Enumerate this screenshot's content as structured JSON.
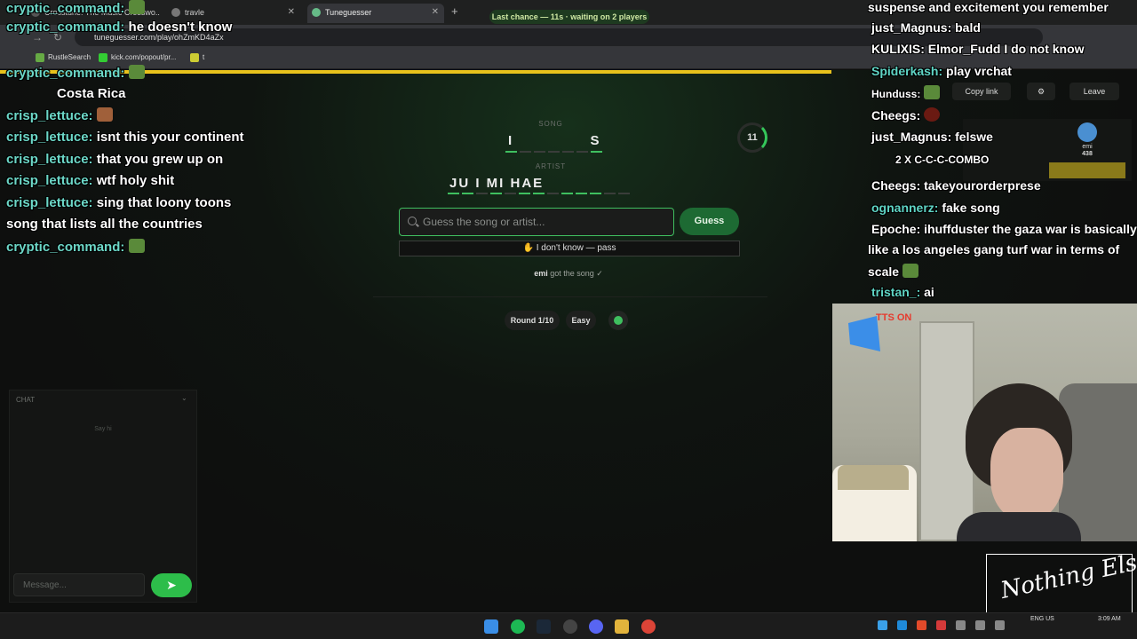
{
  "browser": {
    "tabs": [
      {
        "title": "Crosstune: The Music Crosswo..."
      },
      {
        "title": "travle"
      },
      {
        "title": "Tuneguesser"
      }
    ],
    "url": "tuneguesser.com/play/ohZmKD4aZx",
    "bookmarks": [
      "RustleSearch",
      "kick.com/popout/pr...",
      "t"
    ]
  },
  "game": {
    "banner": "Last chance — 11s · waiting on 2 players",
    "song_label": "SONG",
    "song_hint": "I      S",
    "artist_label": "ARTIST",
    "artist_hint": "JU  I  MI  HAE",
    "timer": "11",
    "search_placeholder": "Guess the song or artist...",
    "guess_label": "Guess",
    "pass_label": "✋ I don't know — pass",
    "got_song_user": "emi",
    "got_song_text": "got the song ✓",
    "round": "Round 1/10",
    "difficulty": "Easy",
    "copy_link": "Copy link",
    "leave": "Leave",
    "player": {
      "name": "emi",
      "score": "438",
      "tag": "prsek"
    }
  },
  "site_chat": {
    "header": "CHAT",
    "empty": "Say hi",
    "placeholder": "Message..."
  },
  "left_chat": [
    {
      "user": "cryptic_command:",
      "text": ""
    },
    {
      "user": "cryptic_command:",
      "text": "he doesn't know"
    },
    {
      "user": "cryptic_command:",
      "text": ""
    },
    {
      "user": "",
      "text": "Costa Rica"
    },
    {
      "user": "crisp_lettuce:",
      "text": ""
    },
    {
      "user": "crisp_lettuce:",
      "text": "isnt this your continent"
    },
    {
      "user": "crisp_lettuce:",
      "text": "that you grew up on"
    },
    {
      "user": "crisp_lettuce:",
      "text": "wtf holy shit"
    },
    {
      "user": "crisp_lettuce:",
      "text": "sing that loony toons"
    },
    {
      "user": "",
      "text": "song that lists all the countries"
    },
    {
      "user": "cryptic_command:",
      "text": ""
    }
  ],
  "right_chat": [
    {
      "user": "",
      "text": "suspense and excitement you remember"
    },
    {
      "user": "just_Magnus:",
      "text": "bald"
    },
    {
      "user": "KULIXIS:",
      "text": "Elmor_Fudd I do not know"
    },
    {
      "user": "Spiderkash:",
      "text": "play vrchat"
    },
    {
      "user": "Hunduss:",
      "text": ""
    },
    {
      "user": "Cheegs:",
      "text": ""
    },
    {
      "user": "just_Magnus:",
      "text": "felswe"
    },
    {
      "user": "",
      "text": "2 X C-C-C-COMBO"
    },
    {
      "user": "Cheegs:",
      "text": "takeyourorderprese"
    },
    {
      "user": "ognannerz:",
      "text": "fake song"
    },
    {
      "user": "Epoche:",
      "text": "ihuffduster the gaza war is basically"
    },
    {
      "user": "",
      "text": "like a los angeles gang turf war in terms of"
    },
    {
      "user": "",
      "text": "scale"
    },
    {
      "user": "tristan_:",
      "text": "ai"
    }
  ],
  "overlay": {
    "tts": "TTS ON",
    "logo": "Nothing Else?"
  },
  "taskbar": {
    "time": "3:09 AM",
    "lang": "ENG US"
  },
  "colors": {
    "accent_green": "#3fbf5f",
    "timer_yellow": "#e8c21c",
    "username_teal": "#6cd7c7"
  }
}
